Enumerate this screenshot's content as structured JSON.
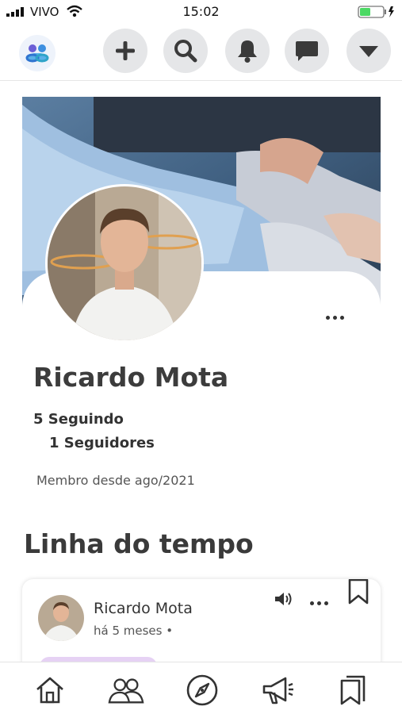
{
  "status_bar": {
    "carrier": "VIVO",
    "time": "15:02",
    "battery_color": "#4cd964"
  },
  "top_nav": {
    "icons": [
      "app-logo",
      "plus-icon",
      "search-icon",
      "bell-icon",
      "chat-icon",
      "caret-down-icon"
    ],
    "button_bg": "#e5e6e8"
  },
  "profile": {
    "name": "Ricardo Mota",
    "following": "5 Seguindo",
    "followers": "1 Seguidores",
    "member_since": "Membro desde ago/2021"
  },
  "timeline": {
    "title": "Linha do tempo",
    "posts": [
      {
        "author": "Ricardo Mota",
        "time": "há 5 meses •",
        "tag_color": "#e6d2f4"
      }
    ]
  },
  "bottom_nav": {
    "items": [
      "home-icon",
      "people-icon",
      "compass-icon",
      "megaphone-icon",
      "bookmarks-icon"
    ]
  }
}
